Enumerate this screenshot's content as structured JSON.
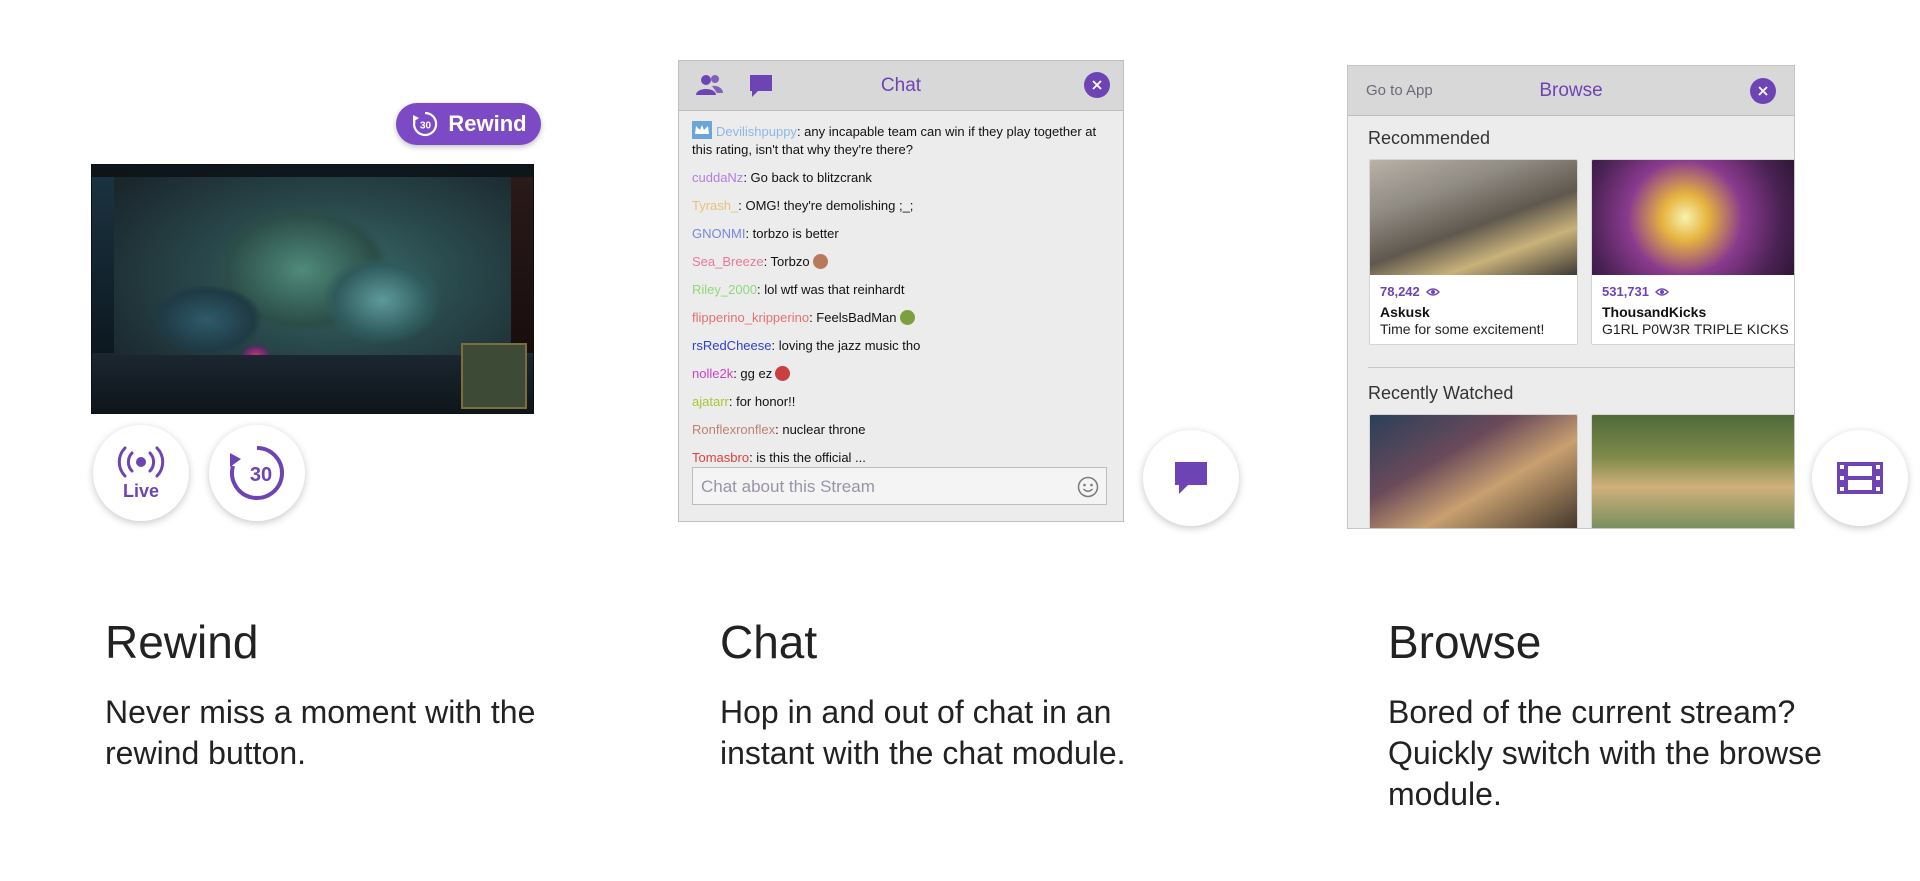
{
  "rewind": {
    "pill_label": "Rewind",
    "pill_icon_number": "30",
    "live_label": "Live",
    "rewind_number": "30",
    "title": "Rewind",
    "description": "Never miss a moment with the rewind button."
  },
  "chat": {
    "title": "Chat",
    "messages": [
      {
        "user": "Devilishpuppy",
        "color": "#8fb7e8",
        "badge": "crown",
        "text": ": any incapable team can win if they play together at this rating, isn't that why they're there?"
      },
      {
        "user": "cuddaNz",
        "color": "#b080e0",
        "text": ": Go back to blitzcrank"
      },
      {
        "user": "Tyrash_",
        "color": "#e8c27a",
        "text": ": OMG! they're demolishing ;_;"
      },
      {
        "user": "GNONMI",
        "color": "#7a86d8",
        "text": ": torbzo is better"
      },
      {
        "user": "Sea_Breeze",
        "color": "#e87a9a",
        "text": ": Torbzo",
        "emote": "#b87a5a"
      },
      {
        "user": "Riley_2000",
        "color": "#8fd87a",
        "text": ": lol wtf was that reinhardt"
      },
      {
        "user": "flipperino_kripperino",
        "color": "#e87070",
        "text": ": FeelsBadMan",
        "emote": "#7aa040"
      },
      {
        "user": "rsRedCheese",
        "color": "#3040d0",
        "text": ": loving the jazz music tho"
      },
      {
        "user": "nolle2k",
        "color": "#d040c0",
        "text": ": gg ez",
        "emote": "#c84040"
      },
      {
        "user": "ajatarr",
        "color": "#a8c830",
        "text": ": for honor!!"
      },
      {
        "user": "Ronflexronflex",
        "color": "#c08070",
        "text": ": nuclear throne"
      },
      {
        "user": "Tomasbro",
        "color": "#e04040",
        "text": ": is this the official ... "
      }
    ],
    "input_placeholder": "Chat about this Stream",
    "heading": "Chat",
    "description": "Hop in and out of chat in an instant with the chat module."
  },
  "browse": {
    "go_to_app": "Go to App",
    "title": "Browse",
    "recommended_label": "Recommended",
    "recommended": [
      {
        "viewers": "78,242",
        "channel": "Askusk",
        "description": "Time for some excitement!"
      },
      {
        "viewers": "531,731",
        "channel": "ThousandKicks",
        "description": "G1RL P0W3R TRIPLE KICKS"
      }
    ],
    "recent_label": "Recently Watched",
    "heading": "Browse",
    "description": "Bored of the current stream? Quickly switch with the browse module."
  },
  "colors": {
    "accent": "#6e44b4",
    "pill": "#7d4ac5"
  }
}
